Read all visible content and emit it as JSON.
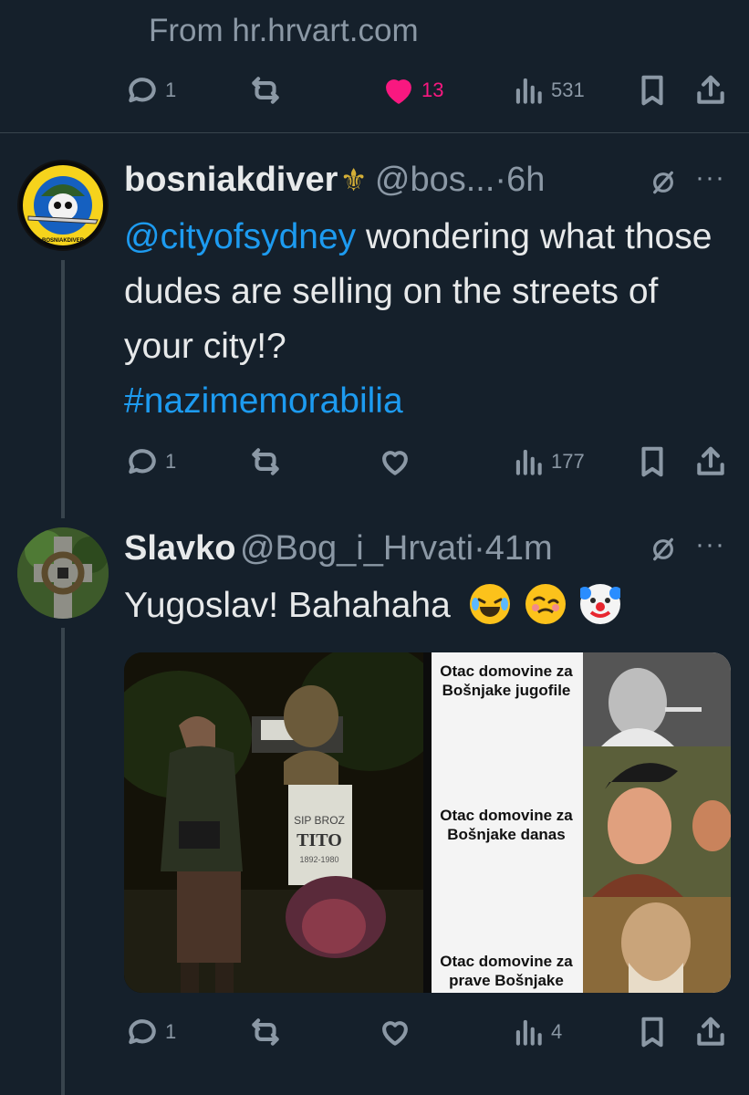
{
  "top_tweet": {
    "source_text": "From hr.hrvart.com",
    "actions": {
      "replies": "1",
      "likes": "13",
      "views": "531"
    }
  },
  "tweet1": {
    "display_name": "bosniakdiver",
    "handle_time": "@bos...·6h",
    "mention": "@cityofsydney",
    "text_after_mention": " wondering what those dudes are selling on the streets of your city!?",
    "hashtag": "#nazimemorabilia",
    "actions": {
      "replies": "1",
      "views": "177"
    },
    "avatar_ring_text": "BOSNIAKDIVER"
  },
  "tweet2": {
    "display_name": "Slavko",
    "handle_time": "@Bog_i_Hrvati·41m",
    "text": "Yugoslav! Bahahaha",
    "media": {
      "plaque_line1": "SIP BROZ",
      "plaque_line2": "TITO",
      "plaque_line3": "1892-1980",
      "captions": [
        "Otac domovine za Bošnjake jugofile",
        "Otac domovine za Bošnjake danas",
        "Otac domovine za prave Bošnjake"
      ]
    },
    "actions": {
      "replies": "1",
      "views": "4"
    }
  },
  "colors": {
    "background": "#15202b",
    "text": "#e7e9ea",
    "muted": "#8b98a5",
    "link": "#1d9bf0",
    "like": "#f91880",
    "divider": "#38444d"
  }
}
